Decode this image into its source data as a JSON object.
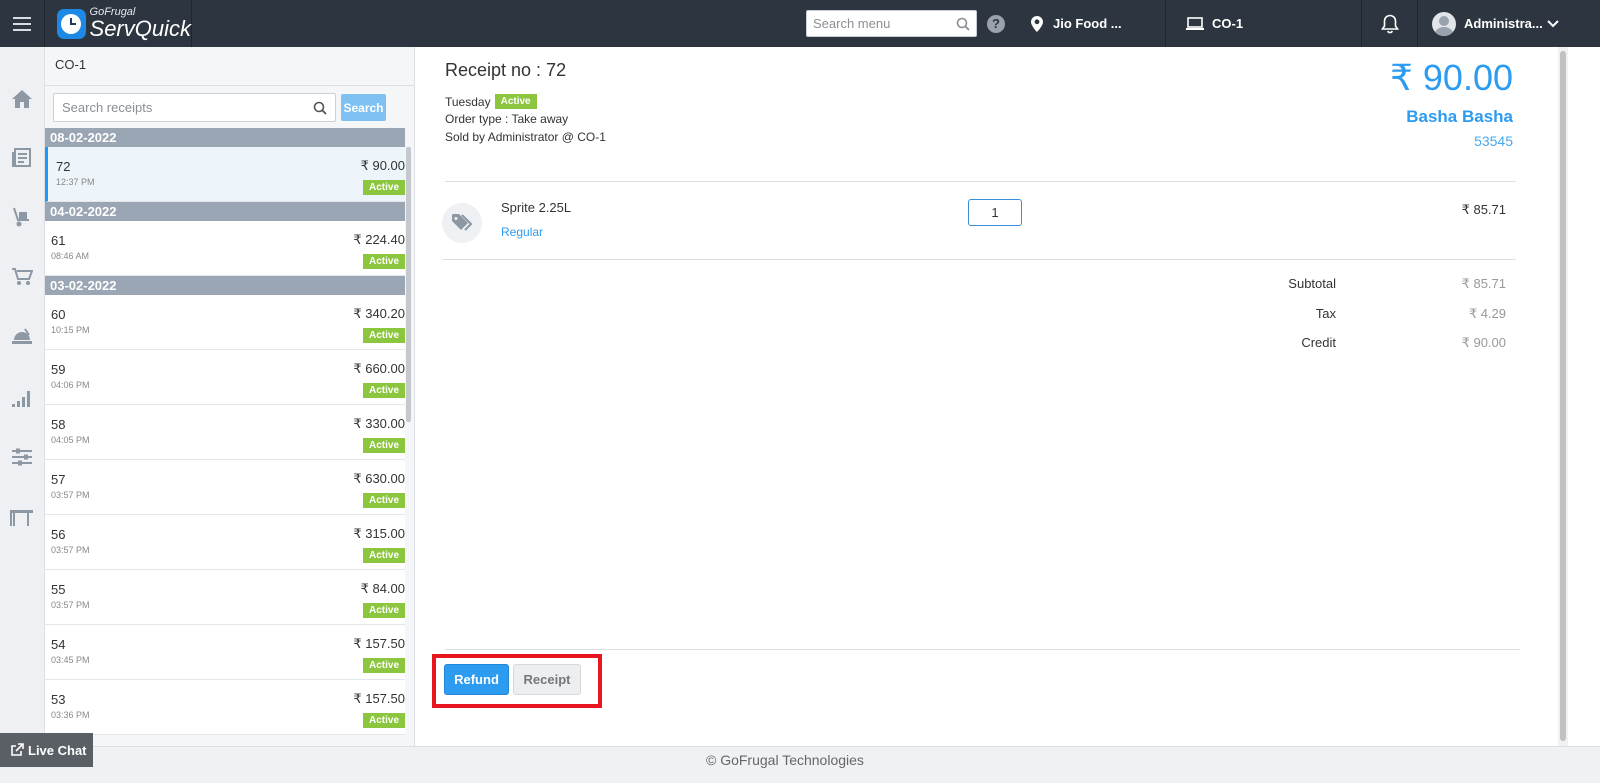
{
  "app": {
    "brand_small": "GoFrugal",
    "brand_name": "ServQuick"
  },
  "topbar": {
    "search_placeholder": "Search menu",
    "help_label": "?",
    "location": "Jio Food ...",
    "outlet": "CO-1",
    "user": "Administra..."
  },
  "list": {
    "outlet_title": "CO-1",
    "search_placeholder": "Search receipts",
    "search_button": "Search",
    "groups": [
      {
        "date": "08-02-2022",
        "receipts": [
          {
            "number": "72",
            "time": "12:37 PM",
            "amount": "₹ 90.00",
            "status": "Active",
            "selected": true
          }
        ]
      },
      {
        "date": "04-02-2022",
        "receipts": [
          {
            "number": "61",
            "time": "08:46 AM",
            "amount": "₹ 224.40",
            "status": "Active"
          }
        ]
      },
      {
        "date": "03-02-2022",
        "receipts": [
          {
            "number": "60",
            "time": "10:15 PM",
            "amount": "₹ 340.20",
            "status": "Active"
          },
          {
            "number": "59",
            "time": "04:06 PM",
            "amount": "₹ 660.00",
            "status": "Active"
          },
          {
            "number": "58",
            "time": "04:05 PM",
            "amount": "₹ 330.00",
            "status": "Active"
          },
          {
            "number": "57",
            "time": "03:57 PM",
            "amount": "₹ 630.00",
            "status": "Active"
          },
          {
            "number": "56",
            "time": "03:57 PM",
            "amount": "₹ 315.00",
            "status": "Active"
          },
          {
            "number": "55",
            "time": "03:57 PM",
            "amount": "₹ 84.00",
            "status": "Active"
          },
          {
            "number": "54",
            "time": "03:45 PM",
            "amount": "₹ 157.50",
            "status": "Active"
          },
          {
            "number": "53",
            "time": "03:36 PM",
            "amount": "₹ 157.50",
            "status": "Active"
          }
        ]
      }
    ]
  },
  "detail": {
    "title": "Receipt no : 72",
    "day": "Tuesday",
    "status": "Active",
    "order_type": "Order type : Take away",
    "sold_by": "Sold by Administrator @ CO-1",
    "total": "₹ 90.00",
    "customer_name": "Basha Basha",
    "customer_id": "53545",
    "item": {
      "name": "Sprite 2.25L",
      "variant": "Regular",
      "quantity": "1",
      "price": "₹ 85.71"
    },
    "summary": [
      {
        "label": "Subtotal",
        "value": "₹ 85.71"
      },
      {
        "label": "Tax",
        "value": "₹ 4.29"
      },
      {
        "label": "Credit",
        "value": "₹ 90.00"
      }
    ],
    "refund_button": "Refund",
    "receipt_button": "Receipt"
  },
  "footer": {
    "copyright": "© GoFrugal Technologies",
    "live_chat": "Live Chat"
  }
}
